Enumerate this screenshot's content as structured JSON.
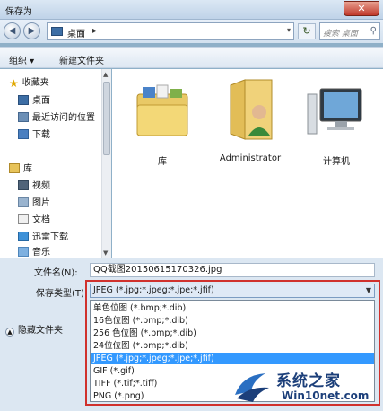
{
  "window": {
    "title": "保存为",
    "close_label": "✕"
  },
  "nav": {
    "back_icon": "◀",
    "forward_icon": "▶",
    "address_crumb": "桌面",
    "address_arrow": "▸",
    "address_dropdown": "▾",
    "refresh_icon": "↻",
    "search_placeholder": "搜索 桌面"
  },
  "toolbar": {
    "organize_label": "组织 ▾",
    "new_folder_label": "新建文件夹"
  },
  "sidebar": {
    "items": [
      {
        "label": "收藏夹",
        "icon": "star-icon"
      },
      {
        "label": "桌面",
        "icon": "desktop-icon"
      },
      {
        "label": "最近访问的位置",
        "icon": "recent-places-icon"
      },
      {
        "label": "下载",
        "icon": "downloads-icon"
      },
      {
        "label": "库",
        "icon": "library-icon"
      },
      {
        "label": "视频",
        "icon": "video-icon"
      },
      {
        "label": "图片",
        "icon": "pictures-icon"
      },
      {
        "label": "文档",
        "icon": "documents-icon"
      },
      {
        "label": "迅雷下载",
        "icon": "thunder-download-icon"
      },
      {
        "label": "音乐",
        "icon": "music-icon"
      }
    ]
  },
  "main": {
    "tiles": [
      {
        "label": "库",
        "icon": "library-folder-icon"
      },
      {
        "label": "Administrator",
        "icon": "user-folder-icon"
      },
      {
        "label": "计算机",
        "icon": "computer-icon"
      }
    ]
  },
  "form": {
    "filename_label": "文件名(N):",
    "filename_value": "QQ截图20150615170326.jpg",
    "filetype_label": "保存类型(T):",
    "filetype_value": "JPEG (*.jpg;*.jpeg;*.jpe;*.jfif)",
    "hide_folders_label": "隐藏文件夹"
  },
  "filetype_options": [
    {
      "label": "单色位图 (*.bmp;*.dib)"
    },
    {
      "label": "16色位图 (*.bmp;*.dib)"
    },
    {
      "label": "256 色位图 (*.bmp;*.dib)"
    },
    {
      "label": "24位位图 (*.bmp;*.dib)"
    },
    {
      "label": "JPEG (*.jpg;*.jpeg;*.jpe;*.jfif)",
      "selected": true
    },
    {
      "label": "GIF (*.gif)"
    },
    {
      "label": "TIFF (*.tif;*.tiff)"
    },
    {
      "label": "PNG (*.png)"
    }
  ],
  "watermark": {
    "title": "系统之家",
    "site": "Win10net.com"
  },
  "colors": {
    "selection": "#3399ff",
    "highlight_outline": "#d0312d",
    "window_frame": "#bfd3e8"
  }
}
